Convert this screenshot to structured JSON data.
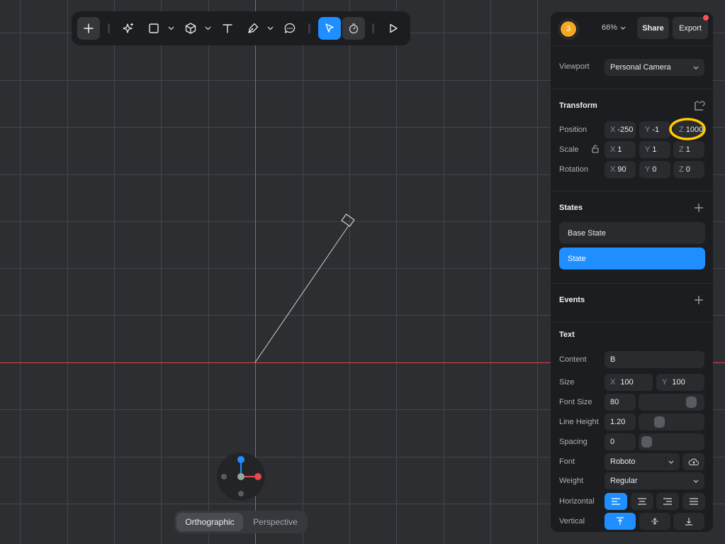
{
  "toolbar": {
    "tools": [
      {
        "icon": "plus-icon",
        "active": false,
        "highlighted": true
      },
      {
        "icon": "sparkle-icon",
        "active": false
      },
      {
        "icon": "rectangle-icon",
        "active": false
      },
      {
        "icon": "cube-icon",
        "active": false
      },
      {
        "icon": "text-icon",
        "active": false
      },
      {
        "icon": "pen-icon",
        "active": false
      },
      {
        "icon": "comment-icon",
        "active": false
      },
      {
        "icon": "select-cursor-icon",
        "active": true
      },
      {
        "icon": "timer-icon",
        "active": false
      },
      {
        "icon": "play-icon",
        "active": false
      }
    ]
  },
  "camera_mode": {
    "options": [
      "Orthographic",
      "Perspective"
    ],
    "selected": "Orthographic"
  },
  "header": {
    "avatar_count": "3",
    "zoom": "66%",
    "share_label": "Share",
    "export_label": "Export",
    "notification_color": "#ff4d5a"
  },
  "viewport": {
    "label": "Viewport",
    "value": "Personal Camera"
  },
  "transform": {
    "title": "Transform",
    "position": {
      "label": "Position",
      "x": "-250",
      "y": "-1",
      "z": "1000"
    },
    "scale": {
      "label": "Scale",
      "x": "1",
      "y": "1",
      "z": "1"
    },
    "rotation": {
      "label": "Rotation",
      "x": "90",
      "y": "0",
      "z": "0"
    },
    "axis_labels": {
      "x": "X",
      "y": "Y",
      "z": "Z"
    }
  },
  "states": {
    "title": "States",
    "items": [
      {
        "label": "Base State",
        "selected": false
      },
      {
        "label": "State",
        "selected": true
      }
    ]
  },
  "events": {
    "title": "Events"
  },
  "text_props": {
    "title": "Text",
    "content": {
      "label": "Content",
      "value": "B"
    },
    "size": {
      "label": "Size",
      "x": "100",
      "y": "100"
    },
    "font_size": {
      "label": "Font Size",
      "value": "80",
      "slider_fraction": 0.9
    },
    "line_height": {
      "label": "Line Height",
      "value": "1.20",
      "slider_fraction": 0.25
    },
    "spacing": {
      "label": "Spacing",
      "value": "0",
      "slider_fraction": 0.0
    },
    "font": {
      "label": "Font",
      "value": "Roboto"
    },
    "weight": {
      "label": "Weight",
      "value": "Regular"
    },
    "horizontal": {
      "label": "Horizontal",
      "selected_index": 0,
      "options": [
        "align-left-icon",
        "align-center-icon",
        "align-right-icon",
        "align-justify-icon"
      ]
    },
    "vertical": {
      "label": "Vertical",
      "selected_index": 0,
      "options": [
        "align-top-icon",
        "align-middle-icon",
        "align-bottom-icon"
      ]
    }
  },
  "colors": {
    "accent": "#1f8fff",
    "x_axis": "#e5484d",
    "y_axis": "#1f8fff",
    "annotation": "#ffcc00",
    "avatar": "#f5a623"
  }
}
